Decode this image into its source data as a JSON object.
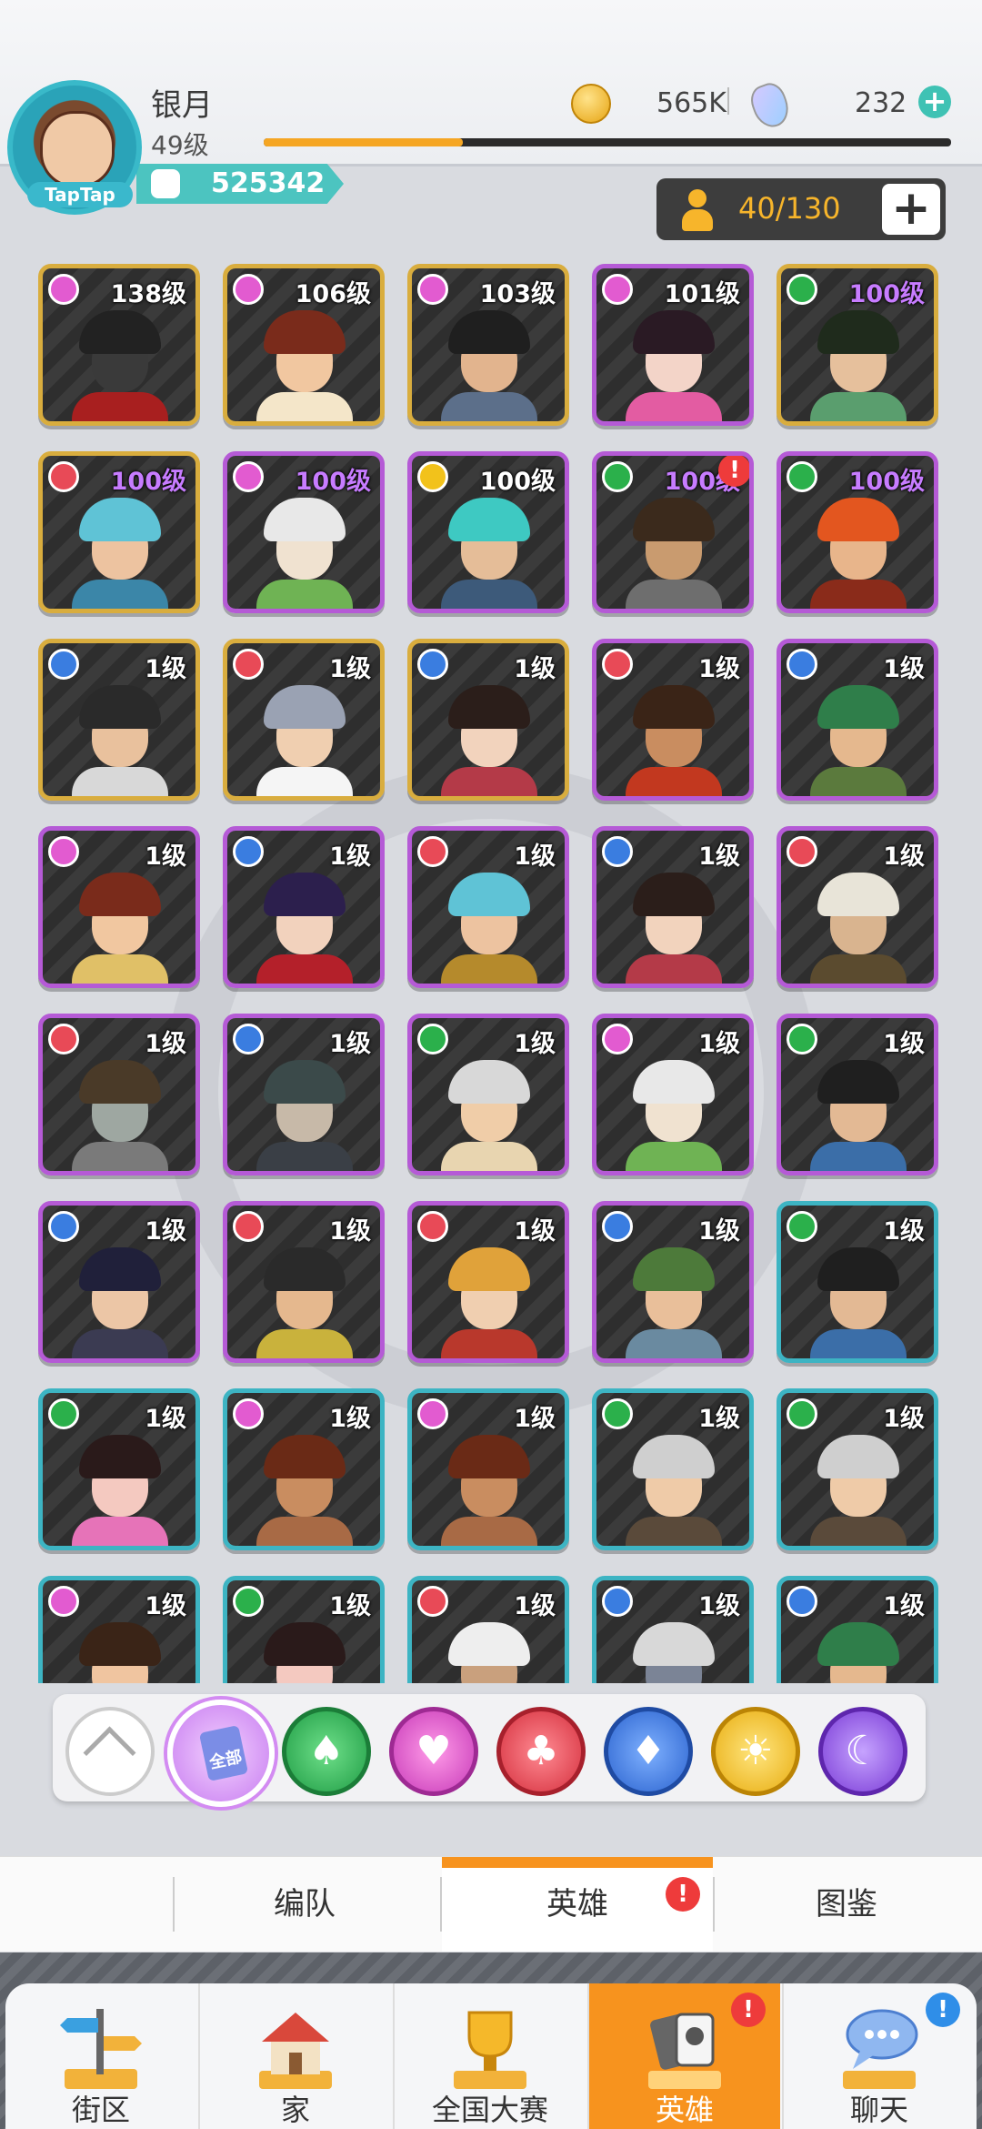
{
  "player": {
    "name": "银月",
    "level": "49级",
    "power": "525342",
    "xp_fraction": 0.29
  },
  "currency": {
    "gold": "565K",
    "gems": "232"
  },
  "avatar": {
    "tag": "TapTap"
  },
  "roster": {
    "capacity": "40/130"
  },
  "heroes": [
    {
      "level": "138级",
      "suit": "heart",
      "frame": "gold",
      "skin": "#3a3a3a",
      "hair": "#222",
      "body": "#a81f1f"
    },
    {
      "level": "106级",
      "suit": "heart",
      "frame": "gold",
      "skin": "#f1c7a0",
      "hair": "#7a2b1b",
      "body": "#f4e6c9"
    },
    {
      "level": "103级",
      "suit": "heart",
      "frame": "gold",
      "skin": "#e2b48e",
      "hair": "#1f1f1f",
      "body": "#5c6f8a"
    },
    {
      "level": "101级",
      "suit": "heart",
      "frame": "purple",
      "skin": "#f3d4c8",
      "hair": "#2a1a24",
      "body": "#e35ca2"
    },
    {
      "level": "100级",
      "suit": "spade",
      "frame": "gold",
      "level_color": "violet",
      "skin": "#e6c09c",
      "hair": "#1f2b1c",
      "body": "#5a9e6e"
    },
    {
      "level": "100级",
      "suit": "club",
      "frame": "gold",
      "level_color": "violet",
      "skin": "#edc3a0",
      "hair": "#5fc3d6",
      "body": "#3b86a8"
    },
    {
      "level": "100级",
      "suit": "heart",
      "frame": "purple",
      "level_color": "violet",
      "skin": "#f0e2d0",
      "hair": "#e8e8e8",
      "body": "#6fb354"
    },
    {
      "level": "100级",
      "suit": "sun",
      "frame": "purple",
      "skin": "#e5bd98",
      "hair": "#3ec9c2",
      "body": "#3d5a7a"
    },
    {
      "level": "100级",
      "suit": "spade",
      "frame": "purple",
      "level_color": "violet",
      "alert": true,
      "skin": "#c99b6f",
      "hair": "#3b2a1c",
      "body": "#6e6e6e"
    },
    {
      "level": "100级",
      "suit": "spade",
      "frame": "purple",
      "level_color": "violet",
      "skin": "#e8b58b",
      "hair": "#e3561f",
      "body": "#8a2b1a"
    },
    {
      "level": "1级",
      "suit": "diamond",
      "frame": "gold",
      "skin": "#e9c19d",
      "hair": "#2a2a2a",
      "body": "#d8d8d8"
    },
    {
      "level": "1级",
      "suit": "club",
      "frame": "gold",
      "skin": "#f0cfb0",
      "hair": "#9aa2b3",
      "body": "#f5f5f5"
    },
    {
      "level": "1级",
      "suit": "diamond",
      "frame": "gold",
      "skin": "#f2d3bd",
      "hair": "#2b1e1a",
      "body": "#b43a48"
    },
    {
      "level": "1级",
      "suit": "club",
      "frame": "purple",
      "skin": "#c98d60",
      "hair": "#3a2417",
      "body": "#c2381f"
    },
    {
      "level": "1级",
      "suit": "diamond",
      "frame": "purple",
      "skin": "#e5b88e",
      "hair": "#2f7e4a",
      "body": "#5b7a3d"
    },
    {
      "level": "1级",
      "suit": "heart",
      "frame": "purple",
      "skin": "#f1c7a0",
      "hair": "#7a2b1b",
      "body": "#e0c067"
    },
    {
      "level": "1级",
      "suit": "diamond",
      "frame": "purple",
      "skin": "#f2d2bd",
      "hair": "#2c1f4d",
      "body": "#b4202a"
    },
    {
      "level": "1级",
      "suit": "club",
      "frame": "purple",
      "skin": "#edc3a0",
      "hair": "#5fc3d6",
      "body": "#b58a2c"
    },
    {
      "level": "1级",
      "suit": "diamond",
      "frame": "purple",
      "skin": "#f2d3bd",
      "hair": "#2b1e1a",
      "body": "#b43a48"
    },
    {
      "level": "1级",
      "suit": "club",
      "frame": "purple",
      "skin": "#d9b48f",
      "hair": "#e8e4d8",
      "body": "#5b4b2f"
    },
    {
      "level": "1级",
      "suit": "club",
      "frame": "purple",
      "skin": "#9ea7a1",
      "hair": "#4a3a28",
      "body": "#7a7a7a"
    },
    {
      "level": "1级",
      "suit": "diamond",
      "frame": "purple",
      "skin": "#c7b9a8",
      "hair": "#3b4a4a",
      "body": "#3a3f46"
    },
    {
      "level": "1级",
      "suit": "spade",
      "frame": "purple",
      "skin": "#f0cda8",
      "hair": "#d8d8d8",
      "body": "#e8d5b0"
    },
    {
      "level": "1级",
      "suit": "heart",
      "frame": "purple",
      "skin": "#f0e2d0",
      "hair": "#e8e8e8",
      "body": "#6fb354"
    },
    {
      "level": "1级",
      "suit": "spade",
      "frame": "purple",
      "skin": "#e3b994",
      "hair": "#1f1f1f",
      "body": "#3b6ea8"
    },
    {
      "level": "1级",
      "suit": "diamond",
      "frame": "purple",
      "skin": "#ecc6a6",
      "hair": "#20203a",
      "body": "#3b3b52"
    },
    {
      "level": "1级",
      "suit": "club",
      "frame": "purple",
      "skin": "#e5b88e",
      "hair": "#2a2a2a",
      "body": "#c9b23c"
    },
    {
      "level": "1级",
      "suit": "club",
      "frame": "purple",
      "skin": "#f0cfb0",
      "hair": "#e0a23a",
      "body": "#b9382c"
    },
    {
      "level": "1级",
      "suit": "diamond",
      "frame": "purple",
      "skin": "#e9bf9a",
      "hair": "#4d7a3a",
      "body": "#6a8aa0"
    },
    {
      "level": "1级",
      "suit": "spade",
      "frame": "teal",
      "skin": "#e3b994",
      "hair": "#1f1f1f",
      "body": "#3b6ea8"
    },
    {
      "level": "1级",
      "suit": "spade",
      "frame": "teal",
      "skin": "#f4c9c0",
      "hair": "#2a1a1a",
      "body": "#e673b8"
    },
    {
      "level": "1级",
      "suit": "heart",
      "frame": "teal",
      "skin": "#c98d60",
      "hair": "#6a2a16",
      "body": "#a86a45"
    },
    {
      "level": "1级",
      "suit": "heart",
      "frame": "teal",
      "skin": "#c98d60",
      "hair": "#6a2a16",
      "body": "#a86a45"
    },
    {
      "level": "1级",
      "suit": "spade",
      "frame": "teal",
      "skin": "#efcba8",
      "hair": "#cfcfcf",
      "body": "#5a4a3a"
    },
    {
      "level": "1级",
      "suit": "spade",
      "frame": "teal",
      "skin": "#efcba8",
      "hair": "#cfcfcf",
      "body": "#5a4a3a"
    },
    {
      "level": "1级",
      "suit": "heart",
      "frame": "teal",
      "skin": "#f0c5a0",
      "hair": "#3a2417",
      "body": "#c23a2a"
    },
    {
      "level": "1级",
      "suit": "spade",
      "frame": "teal",
      "skin": "#f4c9c0",
      "hair": "#2a1a1a",
      "body": "#e673b8"
    },
    {
      "level": "1级",
      "suit": "club",
      "frame": "teal",
      "skin": "#c9a07d",
      "hair": "#eeeeee",
      "body": "#6a4a35"
    },
    {
      "level": "1级",
      "suit": "diamond",
      "frame": "teal",
      "skin": "#7b8496",
      "hair": "#d8d8d8",
      "body": "#3a4050"
    },
    {
      "level": "1级",
      "suit": "diamond",
      "frame": "teal",
      "skin": "#e5b88e",
      "hair": "#2f7e4a",
      "body": "#5b7a3d"
    }
  ],
  "filters": {
    "all_label": "全部",
    "items": [
      "collapse",
      "all",
      "spade",
      "heart",
      "club",
      "diamond",
      "sun",
      "moon"
    ]
  },
  "tabs": {
    "formation": "编队",
    "heroes": "英雄",
    "codex": "图鉴",
    "alert_mark": "!"
  },
  "nav": {
    "district": "街区",
    "home": "家",
    "tournament": "全国大赛",
    "heroes": "英雄",
    "chat": "聊天",
    "alert_mark": "!"
  },
  "colors": {
    "accent": "#f7931e",
    "alert": "#ee3b3b",
    "chat_badge": "#2f8ee8"
  }
}
